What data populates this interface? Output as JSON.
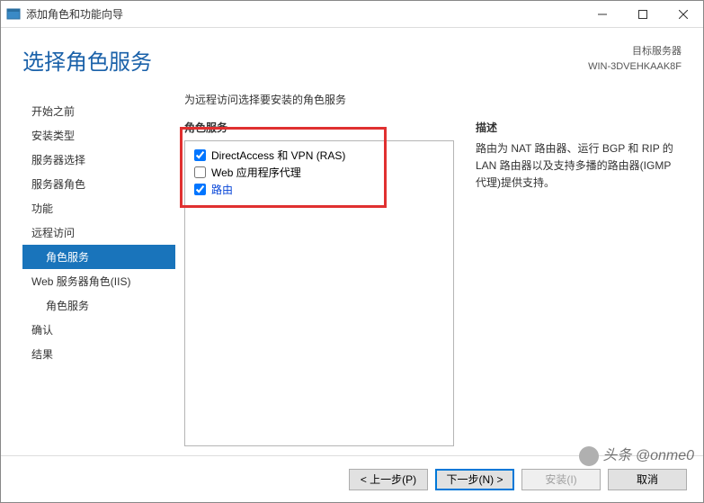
{
  "window": {
    "title": "添加角色和功能向导"
  },
  "header": {
    "title": "选择角色服务",
    "target_label": "目标服务器",
    "target_name": "WIN-3DVEHKAAK8F"
  },
  "sidebar": {
    "items": [
      {
        "label": "开始之前"
      },
      {
        "label": "安装类型"
      },
      {
        "label": "服务器选择"
      },
      {
        "label": "服务器角色"
      },
      {
        "label": "功能"
      },
      {
        "label": "远程访问"
      },
      {
        "label": "角色服务"
      },
      {
        "label": "Web 服务器角色(IIS)"
      },
      {
        "label": "角色服务"
      },
      {
        "label": "确认"
      },
      {
        "label": "结果"
      }
    ]
  },
  "main": {
    "intro": "为远程访问选择要安装的角色服务",
    "roles_label": "角色服务",
    "desc_label": "描述",
    "roles": [
      {
        "label": "DirectAccess 和 VPN (RAS)",
        "checked": true
      },
      {
        "label": "Web 应用程序代理",
        "checked": false
      },
      {
        "label": "路由",
        "checked": true,
        "selected": true
      }
    ],
    "description": "路由为 NAT 路由器、运行 BGP 和 RIP 的 LAN 路由器以及支持多播的路由器(IGMP 代理)提供支持。"
  },
  "buttons": {
    "prev": "< 上一步(P)",
    "next": "下一步(N) >",
    "install": "安装(I)",
    "cancel": "取消"
  },
  "watermark": "头条 @onme0"
}
